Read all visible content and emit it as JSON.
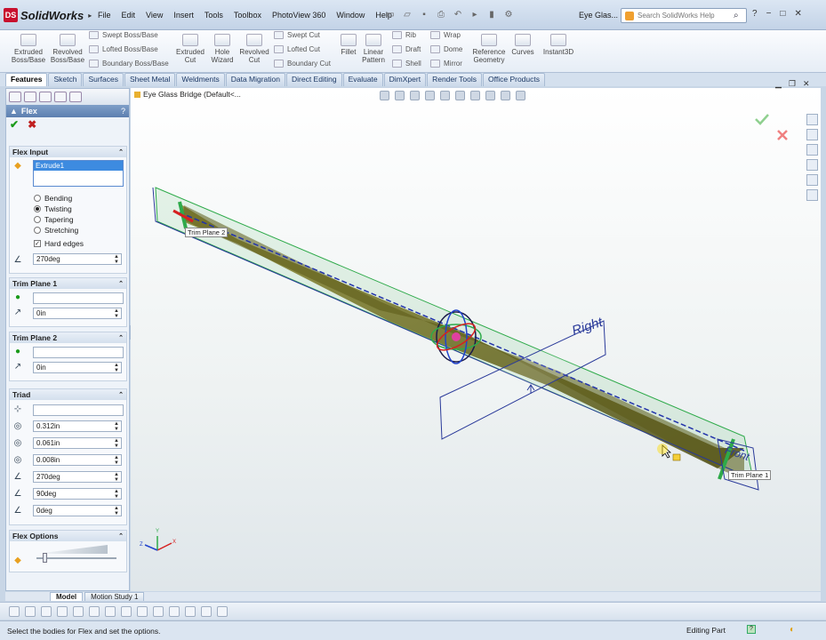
{
  "app": {
    "name": "SolidWorks",
    "logo_text": "DS",
    "doc_title": "Eye Glas...",
    "search_placeholder": "Search SolidWorks Help",
    "window_buttons": [
      "−",
      "□",
      "✕"
    ]
  },
  "menu": [
    "File",
    "Edit",
    "View",
    "Insert",
    "Tools",
    "Toolbox",
    "PhotoView 360",
    "Window",
    "Help"
  ],
  "ribbon": {
    "large": [
      {
        "label": "Extruded\nBoss/Base",
        "icon": "extruded-boss-icon"
      },
      {
        "label": "Revolved\nBoss/Base",
        "icon": "revolved-boss-icon"
      },
      {
        "label": "Extruded\nCut",
        "icon": "extruded-cut-icon"
      },
      {
        "label": "Hole\nWizard",
        "icon": "hole-wizard-icon"
      },
      {
        "label": "Revolved\nCut",
        "icon": "revolved-cut-icon"
      },
      {
        "label": "Fillet",
        "icon": "fillet-icon"
      },
      {
        "label": "Linear\nPattern",
        "icon": "linear-pattern-icon"
      },
      {
        "label": "Reference\nGeometry",
        "icon": "reference-geometry-icon"
      },
      {
        "label": "Curves",
        "icon": "curves-icon"
      },
      {
        "label": "Instant3D",
        "icon": "instant3d-icon"
      }
    ],
    "small": [
      "Swept Boss/Base",
      "Lofted Boss/Base",
      "Boundary Boss/Base",
      "Swept Cut",
      "Lofted Cut",
      "Boundary Cut",
      "Rib",
      "Draft",
      "Shell",
      "Wrap",
      "Dome",
      "Mirror"
    ]
  },
  "tabs": [
    "Features",
    "Sketch",
    "Surfaces",
    "Sheet Metal",
    "Weldments",
    "Data Migration",
    "Direct Editing",
    "Evaluate",
    "DimXpert",
    "Render Tools",
    "Office Products"
  ],
  "active_tab": "Features",
  "property_manager": {
    "title": "Flex",
    "help": "?",
    "flex_input": {
      "header": "Flex Input",
      "selection": "Extrude1",
      "options": [
        "Bending",
        "Twisting",
        "Tapering",
        "Stretching"
      ],
      "selected_option": "Twisting",
      "hard_edges_label": "Hard edges",
      "hard_edges_checked": true,
      "angle": "270deg"
    },
    "trim_plane_1": {
      "header": "Trim Plane 1",
      "selection": "",
      "offset": "0in"
    },
    "trim_plane_2": {
      "header": "Trim Plane 2",
      "selection": "",
      "offset": "0in"
    },
    "triad": {
      "header": "Triad",
      "selection": "",
      "x": "0.312in",
      "y": "0.061in",
      "z": "0.008in",
      "rot1": "270deg",
      "rot2": "90deg",
      "rot3": "0deg"
    },
    "flex_options": {
      "header": "Flex Options",
      "accuracy_fraction": 0.1
    }
  },
  "viewport": {
    "tree_label": "Eye Glass Bridge  (Default<...",
    "labels": {
      "right_plane": "Right",
      "front_plane": "Front",
      "trim_plane_1": "Trim Plane 1",
      "trim_plane_2": "Trim Plane 2"
    },
    "triad_axes": {
      "x": "X",
      "y": "Y",
      "z": "Z"
    }
  },
  "bottom_tabs": [
    "Model",
    "Motion Study 1"
  ],
  "status": {
    "message": "Select the bodies for Flex and set the options.",
    "mode": "Editing Part"
  },
  "colors": {
    "accent": "#5c7fb0",
    "body": "#6b6a1e",
    "plane": "#2a3a9a",
    "bounds": "#2eaa4a"
  }
}
